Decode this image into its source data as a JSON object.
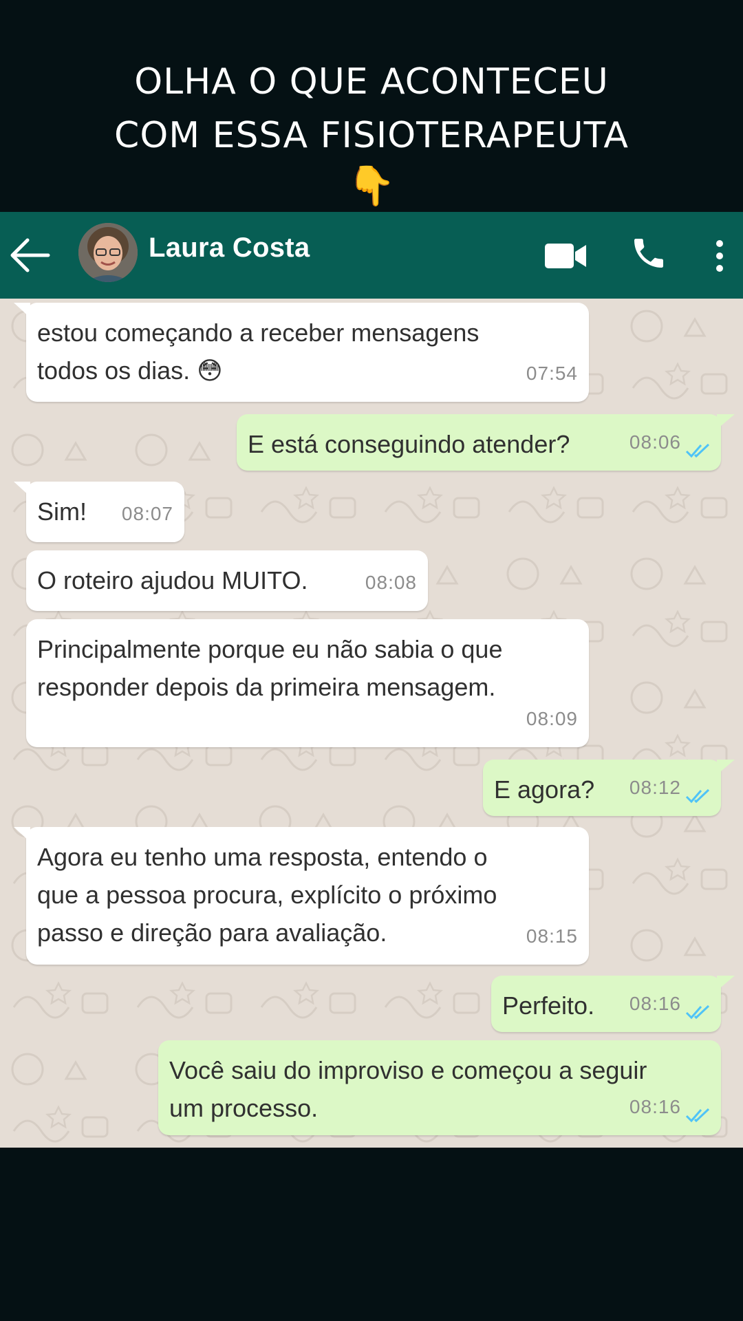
{
  "caption": {
    "line1": "OLHA O QUE ACONTECEU",
    "line2": "COM ESSA FISIOTERAPEUTA",
    "emoji": "👇"
  },
  "header": {
    "contact_name": "Laura Costa",
    "icons": [
      "back-arrow-icon",
      "avatar",
      "video-call-icon",
      "phone-icon",
      "more-options-icon"
    ],
    "color": "#075e54"
  },
  "colors": {
    "incoming_bubble": "#ffffff",
    "outgoing_bubble": "#dcf8c6",
    "chat_background": "#e5ddd5",
    "read_ticks": "#4fc3f7"
  },
  "messages": [
    {
      "direction": "in",
      "text": "estou começando a receber mensagens\ntodos os dias. 😳",
      "time": "07:54"
    },
    {
      "direction": "out",
      "text": "E está conseguindo atender?",
      "time": "08:06",
      "status": "read"
    },
    {
      "direction": "in",
      "text": "Sim!",
      "time": "08:07"
    },
    {
      "direction": "in",
      "text": "O roteiro ajudou MUITO.",
      "time": "08:08"
    },
    {
      "direction": "in",
      "text": "Principalmente porque eu não sabia o que\nresponder depois da primeira mensagem.",
      "time": "08:09"
    },
    {
      "direction": "out",
      "text": "E agora?",
      "time": "08:12",
      "status": "read"
    },
    {
      "direction": "in",
      "text": "Agora eu tenho uma resposta, entendo o\nque a pessoa procura, explícito o próximo\npasso e direção para avaliação.",
      "time": "08:15"
    },
    {
      "direction": "out",
      "text": "Perfeito.",
      "time": "08:16",
      "status": "read"
    },
    {
      "direction": "out",
      "text": "Você saiu do improviso e começou a seguir\num processo.",
      "time": "08:16",
      "status": "read"
    }
  ]
}
